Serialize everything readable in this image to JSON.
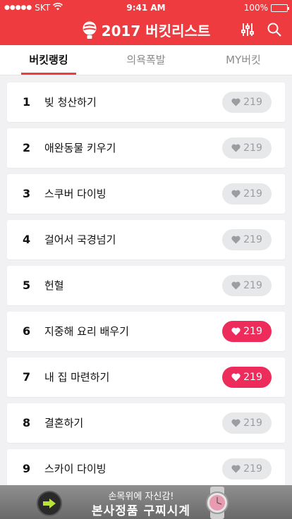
{
  "status_bar": {
    "carrier": "SKT",
    "signal_dots": "●●●●●",
    "time": "9:41 AM",
    "battery": "100%"
  },
  "header": {
    "title": "2017 버킷리스트"
  },
  "tabs": [
    {
      "label": "버킷랭킹"
    },
    {
      "label": "의욕폭발"
    },
    {
      "label": "MY버킷"
    }
  ],
  "items": [
    {
      "rank": "1",
      "name": "빚 청산하기",
      "likes": "219",
      "liked": false
    },
    {
      "rank": "2",
      "name": "애완동물 키우기",
      "likes": "219",
      "liked": false
    },
    {
      "rank": "3",
      "name": "스쿠버 다이빙",
      "likes": "219",
      "liked": false
    },
    {
      "rank": "4",
      "name": "걸어서 국경넘기",
      "likes": "219",
      "liked": false
    },
    {
      "rank": "5",
      "name": "헌혈",
      "likes": "219",
      "liked": false
    },
    {
      "rank": "6",
      "name": "지중해 요리 배우기",
      "likes": "219",
      "liked": true
    },
    {
      "rank": "7",
      "name": "내 집 마련하기",
      "likes": "219",
      "liked": true
    },
    {
      "rank": "8",
      "name": "결혼하기",
      "likes": "219",
      "liked": false
    },
    {
      "rank": "9",
      "name": "스카이 다이빙",
      "likes": "219",
      "liked": false
    }
  ],
  "ad": {
    "line1": "손목위에 자신감!",
    "line2": "본사정품 구찌시계"
  },
  "colors": {
    "brand": "#ee3b3f",
    "liked": "#ee2c5b",
    "unliked_bg": "#e7e8ea"
  }
}
